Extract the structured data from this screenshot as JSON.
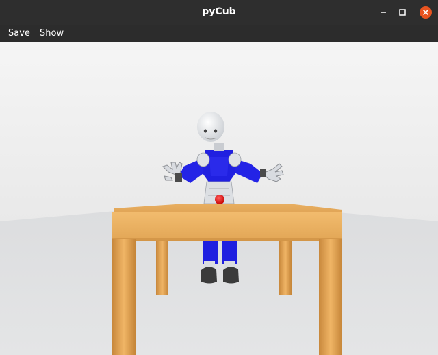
{
  "window": {
    "title": "pyCub",
    "controls": {
      "minimize": "minimize-icon",
      "maximize": "maximize-icon",
      "close": "close-icon",
      "close_color": "#e95420"
    }
  },
  "menu": {
    "items": [
      {
        "label": "Save"
      },
      {
        "label": "Show"
      }
    ]
  },
  "scene": {
    "background_color": "#f0f0f0",
    "floor_color": "#d9dadb",
    "table_color": "#e8b062",
    "robot_color": "#1a1ae6",
    "ball_color": "#e60000"
  }
}
